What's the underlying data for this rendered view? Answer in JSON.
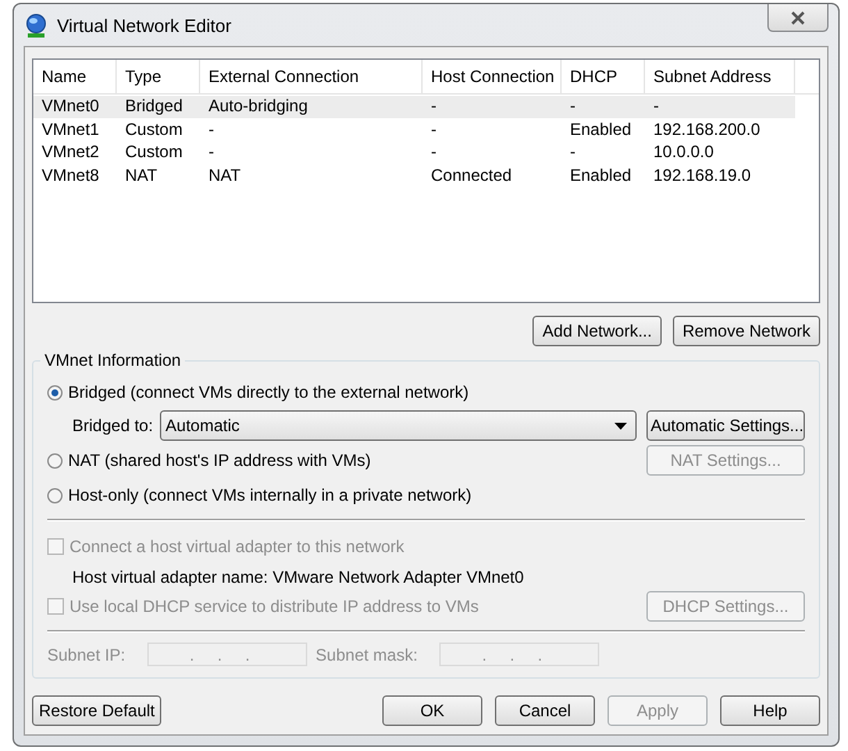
{
  "window": {
    "title": "Virtual Network Editor"
  },
  "table": {
    "columns": [
      "Name",
      "Type",
      "External Connection",
      "Host Connection",
      "DHCP",
      "Subnet Address"
    ],
    "rows": [
      {
        "cells": [
          "VMnet0",
          "Bridged",
          "Auto-bridging",
          "-",
          "-",
          "-"
        ],
        "selected": true
      },
      {
        "cells": [
          "VMnet1",
          "Custom",
          "-",
          "-",
          "Enabled",
          "192.168.200.0"
        ],
        "selected": false
      },
      {
        "cells": [
          "VMnet2",
          "Custom",
          "-",
          "-",
          "-",
          "10.0.0.0"
        ],
        "selected": false
      },
      {
        "cells": [
          "VMnet8",
          "NAT",
          "NAT",
          "Connected",
          "Enabled",
          "192.168.19.0"
        ],
        "selected": false
      }
    ]
  },
  "network_buttons": [
    {
      "label": "Add Network...",
      "disabled": false
    },
    {
      "label": "Remove Network",
      "disabled": false
    }
  ],
  "vmnet_info": {
    "title": "VMnet Information",
    "options": [
      {
        "label": "Bridged (connect VMs directly to the external network)",
        "selected": true,
        "bridged_to": {
          "label": "Bridged to:",
          "value": "Automatic",
          "button": {
            "label": "Automatic Settings...",
            "disabled": false
          }
        }
      },
      {
        "label": "NAT (shared host's IP address with VMs)",
        "selected": false,
        "button": {
          "label": "NAT Settings...",
          "disabled": true
        }
      },
      {
        "label": "Host-only (connect VMs internally in a private network)",
        "selected": false
      }
    ],
    "host_adapter": {
      "label": "Connect a host virtual adapter to this network",
      "checked": false,
      "disabled": true
    },
    "adapter_name": "Host virtual adapter name: VMware Network Adapter VMnet0",
    "dhcp": {
      "label": "Use local DHCP service to distribute IP address to VMs",
      "checked": false,
      "disabled": true,
      "button": {
        "label": "DHCP Settings...",
        "disabled": true
      }
    },
    "subnet_fields": [
      {
        "label": "Subnet IP:",
        "value": "    .     .     .",
        "disabled": true
      },
      {
        "label": "Subnet mask:",
        "value": "    .     .     .",
        "disabled": true
      }
    ]
  },
  "footer_buttons": [
    {
      "label": "Restore Default",
      "disabled": false
    },
    {
      "label": "OK",
      "disabled": false
    },
    {
      "label": "Cancel",
      "disabled": false
    },
    {
      "label": "Apply",
      "disabled": true
    },
    {
      "label": "Help",
      "disabled": false
    }
  ]
}
